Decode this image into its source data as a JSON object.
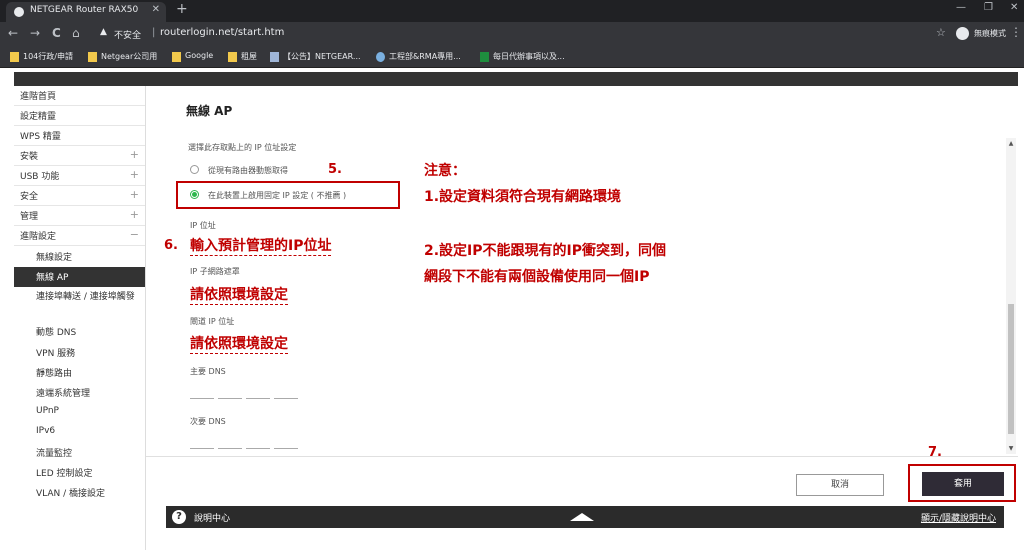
{
  "browser": {
    "tab_title": "NETGEAR Router RAX50",
    "tab_close": "✕",
    "new_tab": "+",
    "window_controls": [
      "—",
      "❐",
      "✕"
    ],
    "nav": {
      "back": "←",
      "forward": "→",
      "reload": "C",
      "home": "⌂"
    },
    "security_label": "不安全",
    "url_separator": "|",
    "url": "routerlogin.net/start.htm",
    "star": "☆",
    "profile_label": "無痕模式",
    "menu": "⋮",
    "bookmarks": [
      {
        "label": "104行政/申請",
        "icon": "folder-icon"
      },
      {
        "label": "Netgear公司用",
        "icon": "folder-icon"
      },
      {
        "label": "Google",
        "icon": "folder-icon"
      },
      {
        "label": "租屋",
        "icon": "folder-icon"
      },
      {
        "label": "【公告】NETGEAR...",
        "icon": "page-icon"
      },
      {
        "label": "工程部&RMA專用...",
        "icon": "globe-icon"
      },
      {
        "label": "每日代辦事項以及...",
        "icon": "sheet-icon"
      }
    ]
  },
  "sidebar": {
    "items": [
      {
        "label": "進階首頁",
        "expand": ""
      },
      {
        "label": "設定精靈",
        "expand": ""
      },
      {
        "label": "WPS 精靈",
        "expand": ""
      },
      {
        "label": "安裝",
        "expand": "+"
      },
      {
        "label": "USB 功能",
        "expand": "+"
      },
      {
        "label": "安全",
        "expand": "+"
      },
      {
        "label": "管理",
        "expand": "+"
      },
      {
        "label": "進階設定",
        "expand": "−"
      }
    ],
    "subitems": [
      {
        "label": "無線設定"
      },
      {
        "label": "無線 AP"
      },
      {
        "label": "連接埠轉送 / 連接埠觸發"
      },
      {
        "label": "動態 DNS"
      },
      {
        "label": "VPN 服務"
      },
      {
        "label": "靜態路由"
      },
      {
        "label": "遠端系統管理"
      },
      {
        "label": "UPnP"
      },
      {
        "label": "IPv6"
      },
      {
        "label": "流量監控"
      },
      {
        "label": "LED 控制設定"
      },
      {
        "label": "VLAN / 橋接設定"
      }
    ]
  },
  "main": {
    "title": "無線 AP",
    "ip_section_label": "選擇此存取點上的 IP 位址設定",
    "option_dynamic": "從現有路由器動態取得",
    "option_static": "在此裝置上啟用固定 IP 設定 ( 不推薦 )",
    "ip_label": "IP 位址",
    "subnet_label": "IP 子網路遮罩",
    "gateway_label": "閘道 IP 位址",
    "dns1_label": "主要 DNS",
    "dns2_label": "次要 DNS",
    "cancel_label": "取消",
    "apply_label": "套用"
  },
  "annotations": {
    "step5": "5.",
    "step6": "6.",
    "step7": "7.",
    "ip_hint": "輸入預計管理的IP位址",
    "subnet_hint": "請依照環境設定",
    "gateway_hint": "請依照環境設定",
    "note_title": "注意：",
    "note1": "1.設定資料須符合現有網路環境",
    "note2_line1": "2.設定IP不能跟現有的IP衝突到，同個",
    "note2_line2": "網段下不能有兩個設備使用同一個IP"
  },
  "help": {
    "icon": "?",
    "label": "說明中心",
    "toggle": "顯示/隱藏說明中心"
  },
  "colors": {
    "annotation_red": "#c00000",
    "annotation_blue": "#1f3a8a",
    "radio_green": "#2db84d",
    "apply_button": "#2f2b36"
  }
}
